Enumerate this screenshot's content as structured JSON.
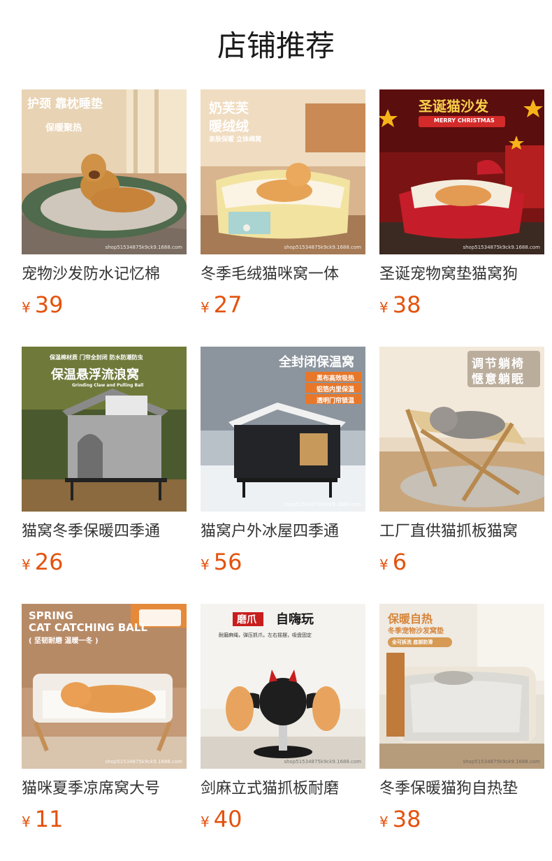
{
  "page": {
    "title": "店铺推荐"
  },
  "colors": {
    "price": "#e4520c",
    "title": "#1a1a1a",
    "name": "#333333"
  },
  "products": [
    {
      "name": "宠物沙发防水记忆棉",
      "currency": "¥",
      "price": "39",
      "watermark": "shop51534875k9ck9.1688.com",
      "banner_lines": [
        "护颈 靠枕睡垫",
        "保暖聚热"
      ],
      "image_icon": "dog-sofa-bed-image"
    },
    {
      "name": "冬季毛绒猫咪窝一体",
      "currency": "¥",
      "price": "27",
      "watermark": "shop51534875k9ck9.1688.com",
      "banner_lines": [
        "奶芙芙",
        "暖绒绒",
        "亲肤保暖 立体绵窝"
      ],
      "image_icon": "cat-plush-bed-image"
    },
    {
      "name": "圣诞宠物窝垫猫窝狗",
      "currency": "¥",
      "price": "38",
      "watermark": "shop51534875k9ck9.1688.com",
      "banner_lines": [
        "圣诞猫沙发",
        "MERRY CHRISTMAS"
      ],
      "image_icon": "christmas-cat-sofa-image"
    },
    {
      "name": "猫窝冬季保暖四季通",
      "currency": "¥",
      "price": "26",
      "watermark": "",
      "banner_lines": [
        "保温棉材质 门帘全封闭 防水防潮防虫",
        "保温悬浮流浪窝",
        "Grinding Claw and Pulling Ball"
      ],
      "image_icon": "outdoor-cat-house-image"
    },
    {
      "name": "猫窝户外冰屋四季通",
      "currency": "¥",
      "price": "56",
      "watermark": "shop51534875k9ck9.1688.com",
      "banner_lines": [
        "全封闭保温窝",
        "黑布高效吸热",
        "铝箔内里保温",
        "透明门帘锁温"
      ],
      "image_icon": "snow-cat-house-image"
    },
    {
      "name": "工厂直供猫抓板猫窝",
      "currency": "¥",
      "price": "6",
      "watermark": "",
      "banner_lines": [
        "调节躺椅",
        "惬意躺眠"
      ],
      "image_icon": "cat-lounge-chair-image"
    },
    {
      "name": "猫咪夏季凉席窝大号",
      "currency": "¥",
      "price": "11",
      "watermark": "shop51534875k9ck9.1688.com",
      "banner_lines": [
        "SPRING",
        "CAT CATCHING BALL",
        "( 坚韧耐磨 温暖一冬 )"
      ],
      "image_icon": "cat-summer-bed-image"
    },
    {
      "name": "剑麻立式猫抓板耐磨",
      "currency": "¥",
      "price": "40",
      "watermark": "shop51534875k9ck9.1688.com",
      "banner_lines": [
        "磨爪",
        "自嗨玩",
        "耐磨麻绳，弹压抓爪，左右摇摆，吸盘固定"
      ],
      "image_icon": "sisal-scratcher-ball-image"
    },
    {
      "name": "冬季保暖猫狗自热垫",
      "currency": "¥",
      "price": "38",
      "watermark": "shop51534875k9ck9.1688.com",
      "banner_lines": [
        "保暖自热",
        "冬季宠物沙发窝垫",
        "全可拆洗 底部防滑"
      ],
      "image_icon": "self-heating-pad-image"
    }
  ]
}
